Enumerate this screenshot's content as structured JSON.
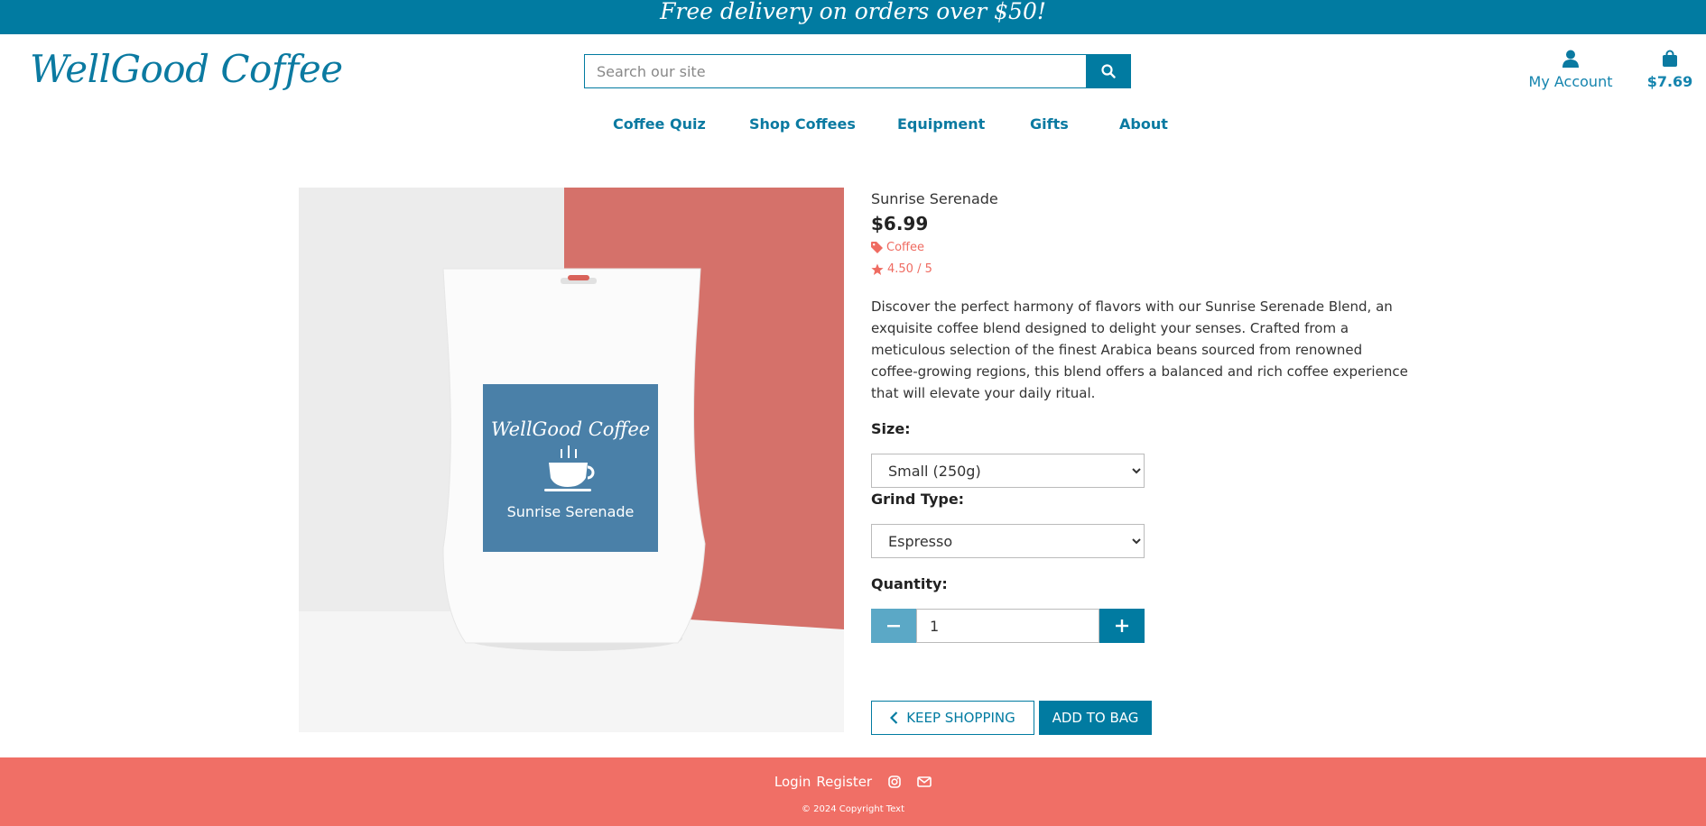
{
  "promo": {
    "text": "Free delivery on orders over $50!"
  },
  "brand": {
    "logo_text": "WellGood Coffee"
  },
  "search": {
    "placeholder": "Search our site"
  },
  "header": {
    "account_label": "My Account",
    "cart_total": "$7.69"
  },
  "nav": {
    "items": [
      {
        "label": "Coffee Quiz"
      },
      {
        "label": "Shop Coffees"
      },
      {
        "label": "Equipment"
      },
      {
        "label": "Gifts"
      },
      {
        "label": "About"
      }
    ]
  },
  "product": {
    "name": "Sunrise Serenade",
    "price": "$6.99",
    "category": "Coffee",
    "rating": "4.50 / 5",
    "description": "Discover the perfect harmony of flavors with our Sunrise Serenade Blend, an exquisite coffee blend designed to delight your senses. Crafted from a meticulous selection of the finest Arabica beans sourced from renowned coffee-growing regions, this blend offers a balanced and rich coffee experience that will elevate your daily ritual.",
    "image_label_brand": "WellGood Coffee",
    "image_label_name": "Sunrise Serenade",
    "size_label": "Size:",
    "size_selected": "Small (250g)",
    "grind_label": "Grind Type:",
    "grind_selected": "Espresso",
    "quantity_label": "Quantity:",
    "quantity_value": "1",
    "keep_shopping_label": "KEEP SHOPPING",
    "add_to_bag_label": "ADD TO BAG"
  },
  "footer": {
    "login_label": "Login",
    "register_label": "Register",
    "copyright": "© 2024 Copyright Text"
  },
  "colors": {
    "primary": "#017ba1",
    "accent": "#ef6b61",
    "footer_bg": "#f06f66",
    "label_blue": "#4a80a8"
  }
}
